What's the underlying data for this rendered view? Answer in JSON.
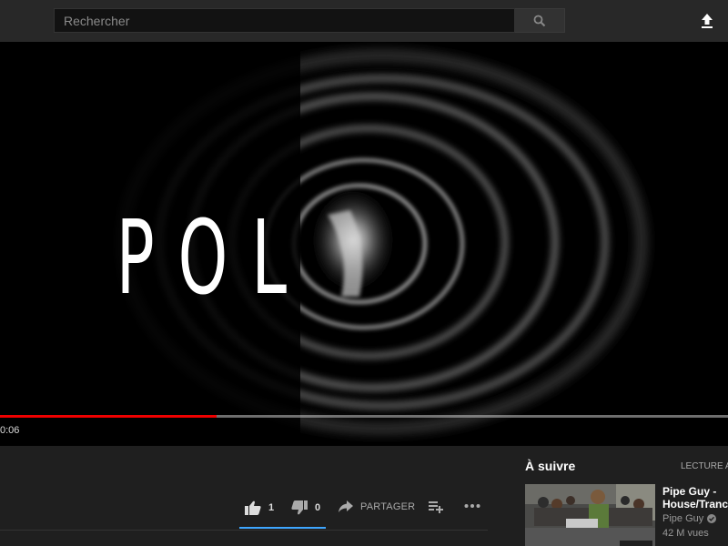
{
  "header": {
    "search_placeholder": "Rechercher",
    "search_icon": "search-icon",
    "upload_icon": "upload-icon"
  },
  "player": {
    "frame_text": "POL",
    "current_time": "0:06",
    "progress_fraction": 0.297,
    "progress_color": "#ee0000"
  },
  "actions": {
    "like_count": "1",
    "dislike_count": "0",
    "share_label": "PARTAGER",
    "accent_color": "#3ea6ff"
  },
  "up_next": {
    "title": "À suivre",
    "autoplay_label": "LECTURE A",
    "items": [
      {
        "title_line1": "Pipe Guy -",
        "title_line2": "House/Trance",
        "channel": "Pipe Guy",
        "views": "42 M vues"
      }
    ]
  }
}
